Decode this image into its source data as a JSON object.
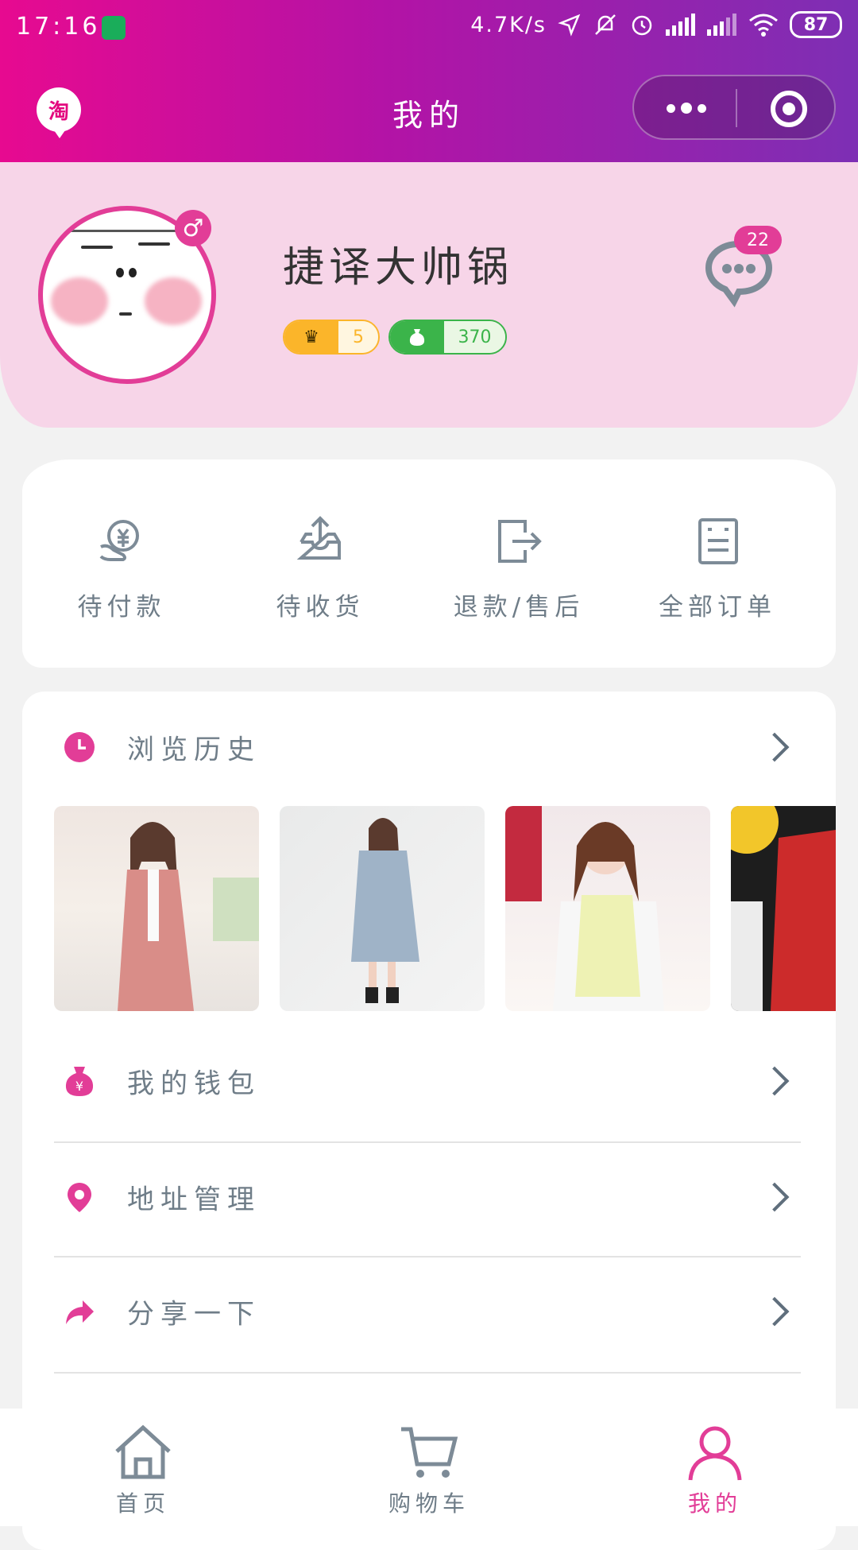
{
  "status_bar": {
    "time": "17:16",
    "net_speed": "4.7K/s",
    "battery": "87"
  },
  "nav": {
    "logo_text": "淘",
    "title": "我的"
  },
  "profile": {
    "username": "捷译大帅锅",
    "level_value": "5",
    "points_value": "370",
    "message_count": "22",
    "gender_symbol": "♂"
  },
  "orders": [
    {
      "label": "待付款",
      "icon": "payment-icon"
    },
    {
      "label": "待收货",
      "icon": "inbox-icon"
    },
    {
      "label": "退款/售后",
      "icon": "refund-icon"
    },
    {
      "label": "全部订单",
      "icon": "order-list-icon"
    }
  ],
  "menu": {
    "history_label": "浏览历史",
    "history_items": [
      "pink coat",
      "blue trench coat",
      "yellow knit top",
      "red sweater"
    ],
    "wallet_label": "我的钱包",
    "address_label": "地址管理",
    "share_label": "分享一下"
  },
  "tabbar": [
    {
      "label": "首页",
      "icon": "home-icon",
      "active": false
    },
    {
      "label": "购物车",
      "icon": "cart-icon",
      "active": false
    },
    {
      "label": "我的",
      "icon": "user-icon",
      "active": true
    }
  ],
  "colors": {
    "accent": "#e23d97",
    "header_start": "#e70a90",
    "header_end": "#7d2fb4",
    "gold": "#fbb52a",
    "green": "#3bb44a",
    "text_grey": "#6f7d88"
  }
}
